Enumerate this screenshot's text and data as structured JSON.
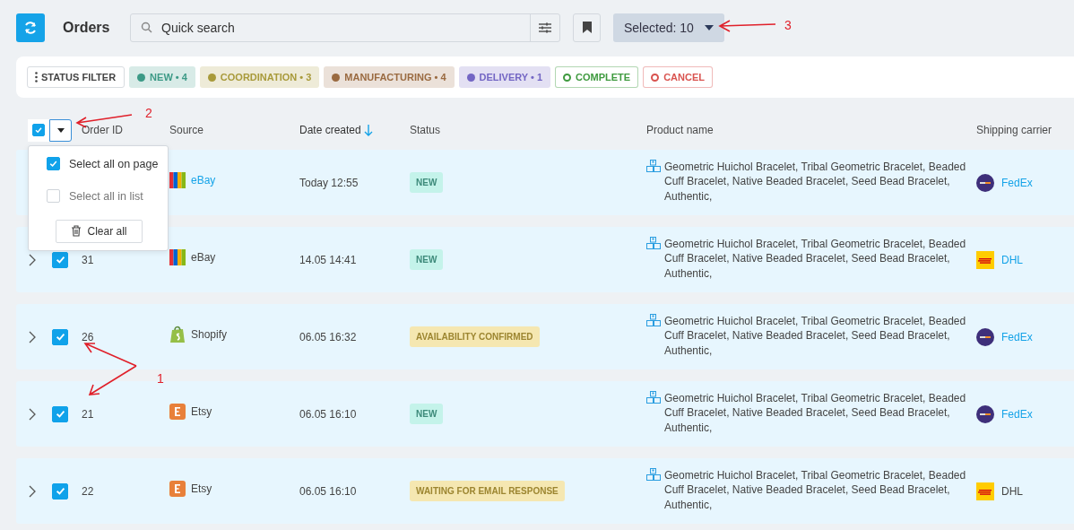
{
  "header": {
    "title": "Orders",
    "search": {
      "placeholder": "Quick search"
    },
    "selection_button": {
      "label": "Selected: 10"
    }
  },
  "status_filter": {
    "label": "STATUS FILTER",
    "chips": [
      {
        "label": "NEW • 4",
        "color": "#3c9a86",
        "kind": "filled"
      },
      {
        "label": "COORDINATION • 3",
        "color": "#a89a3a",
        "kind": "filled"
      },
      {
        "label": "MANUFACTURING • 4",
        "color": "#9a6a40",
        "kind": "filled"
      },
      {
        "label": "DELIVERY • 1",
        "color": "#7366c4",
        "kind": "filled"
      },
      {
        "label": "COMPLETE",
        "color": "#3f9a3f",
        "kind": "outline"
      },
      {
        "label": "CANCEL",
        "color": "#d9534f",
        "kind": "outline"
      }
    ]
  },
  "table": {
    "select_all": {
      "checked": true,
      "expanded": true
    },
    "select_menu": {
      "items": [
        {
          "label": "Select all on page",
          "checked": true
        },
        {
          "label": "Select all in list",
          "checked": false
        }
      ],
      "clear_button": "Clear all"
    },
    "columns": [
      {
        "label": "Order ID",
        "sorted": false
      },
      {
        "label": "Source",
        "sorted": false
      },
      {
        "label": "Date created",
        "sorted": true
      },
      {
        "label": "Status",
        "sorted": false
      },
      {
        "label": "Product name",
        "sorted": false
      },
      {
        "label": "Shipping carrier",
        "sorted": false
      }
    ],
    "rows": [
      {
        "source": {
          "name": "eBay",
          "kind": "ebay",
          "link": true
        },
        "date": "Today 12:55",
        "status": {
          "label": "NEW",
          "kind": "new"
        },
        "product": "Geometric Huichol Bracelet, Tribal Geometric Bracelet, Beaded Cuff Bracelet, Native Beaded Bracelet, Seed Bead Bracelet, Authentic,",
        "carrier": {
          "name": "FedEx",
          "kind": "fedex",
          "link": true
        }
      },
      {
        "order_id": "31",
        "checked": true,
        "source": {
          "name": "eBay",
          "kind": "ebay",
          "link": false
        },
        "date": "14.05 14:41",
        "status": {
          "label": "NEW",
          "kind": "new"
        },
        "product": "Geometric Huichol Bracelet, Tribal Geometric Bracelet, Beaded Cuff Bracelet, Native Beaded Bracelet, Seed Bead Bracelet, Authentic,",
        "carrier": {
          "name": "DHL",
          "kind": "dhl",
          "link": true
        }
      },
      {
        "order_id": "26",
        "checked": true,
        "source": {
          "name": "Shopify",
          "kind": "shopify",
          "link": false
        },
        "date": "06.05 16:32",
        "status": {
          "label": "AVAILABILITY CONFIRMED",
          "kind": "pending"
        },
        "product": "Geometric Huichol Bracelet, Tribal Geometric Bracelet, Beaded Cuff Bracelet, Native Beaded Bracelet, Seed Bead Bracelet, Authentic,",
        "carrier": {
          "name": "FedEx",
          "kind": "fedex",
          "link": true
        }
      },
      {
        "order_id": "21",
        "checked": true,
        "source": {
          "name": "Etsy",
          "kind": "etsy",
          "link": false
        },
        "date": "06.05 16:10",
        "status": {
          "label": "NEW",
          "kind": "new"
        },
        "product": "Geometric Huichol Bracelet, Tribal Geometric Bracelet, Beaded Cuff Bracelet, Native Beaded Bracelet, Seed Bead Bracelet, Authentic,",
        "carrier": {
          "name": "FedEx",
          "kind": "fedex",
          "link": true
        }
      },
      {
        "order_id": "22",
        "checked": true,
        "source": {
          "name": "Etsy",
          "kind": "etsy",
          "link": false
        },
        "date": "06.05 16:10",
        "status": {
          "label": "WAITING FOR EMAIL RESPONSE",
          "kind": "pending"
        },
        "product": "Geometric Huichol Bracelet, Tribal Geometric Bracelet, Beaded Cuff Bracelet, Native Beaded Bracelet, Seed Bead Bracelet, Authentic,",
        "carrier": {
          "name": "DHL",
          "kind": "dhl",
          "link": false
        }
      }
    ]
  },
  "annotations": [
    {
      "label": "3"
    },
    {
      "label": "2"
    },
    {
      "label": "1"
    }
  ]
}
